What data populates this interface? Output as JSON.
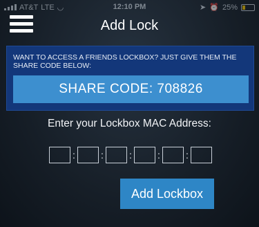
{
  "status_bar": {
    "carrier": "AT&T",
    "network": "LTE",
    "time": "12:10 PM",
    "battery": "25%"
  },
  "header": {
    "title": "Add Lock",
    "menu_icon": "hamburger-menu-icon"
  },
  "share": {
    "prompt": "WANT TO ACCESS A FRIENDS LOCKBOX? JUST GIVE THEM THE SHARE CODE BELOW:",
    "code_text": "SHARE CODE: 708826"
  },
  "mac": {
    "label": "Enter your Lockbox MAC Address:",
    "segments": [
      "",
      "",
      "",
      "",
      "",
      ""
    ],
    "separator": ":"
  },
  "actions": {
    "add_label": "Add Lockbox"
  },
  "colors": {
    "panel_bg": "#13377a",
    "code_bg": "#3d8fcf",
    "button_bg": "#2e86c6"
  }
}
